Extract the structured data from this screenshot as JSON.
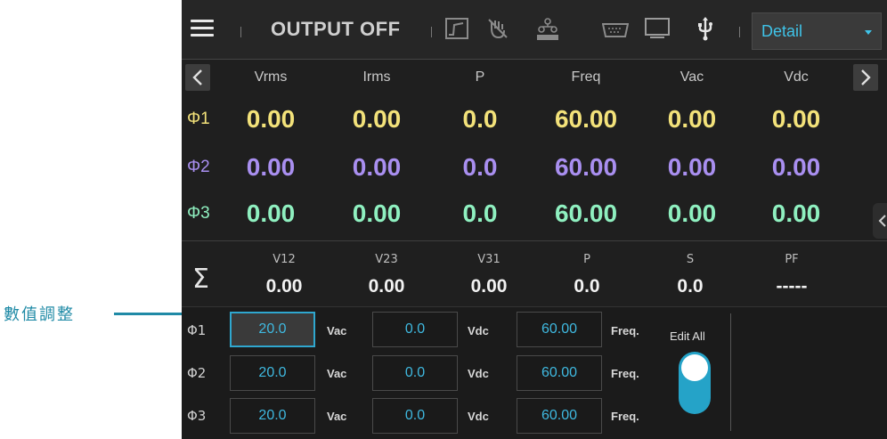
{
  "annotation": {
    "text": "數值調整"
  },
  "toolbar": {
    "status": "OUTPUT OFF",
    "view_select": "Detail",
    "icons": [
      "menu-icon",
      "waveform-icon",
      "hand-icon",
      "master-icon",
      "keyboard-icon",
      "monitor-icon",
      "usb-icon"
    ]
  },
  "measure": {
    "columns": [
      "Vrms",
      "Irms",
      "P",
      "Freq",
      "Vac",
      "Vdc"
    ],
    "rows": [
      {
        "label": "Φ1",
        "color": "#f3e27a",
        "values": [
          "0.00",
          "0.00",
          "0.0",
          "60.00",
          "0.00",
          "0.00"
        ]
      },
      {
        "label": "Φ2",
        "color": "#a98ff0",
        "values": [
          "0.00",
          "0.00",
          "0.0",
          "60.00",
          "0.00",
          "0.00"
        ]
      },
      {
        "label": "Φ3",
        "color": "#8ff0c0",
        "values": [
          "0.00",
          "0.00",
          "0.0",
          "60.00",
          "0.00",
          "0.00"
        ]
      }
    ]
  },
  "summary": {
    "symbol": "Σ",
    "columns": [
      "V12",
      "V23",
      "V31",
      "P",
      "S",
      "PF"
    ],
    "values": [
      "0.00",
      "0.00",
      "0.00",
      "0.0",
      "0.0",
      "-----"
    ]
  },
  "edit": {
    "units": {
      "vac": "Vac",
      "vdc": "Vdc",
      "freq": "Freq."
    },
    "rows": [
      {
        "label": "Φ1",
        "vac": "20.0",
        "vdc": "0.0",
        "freq": "60.00"
      },
      {
        "label": "Φ2",
        "vac": "20.0",
        "vdc": "0.0",
        "freq": "60.00"
      },
      {
        "label": "Φ3",
        "vac": "20.0",
        "vdc": "0.0",
        "freq": "60.00"
      }
    ],
    "edit_all_label": "Edit All",
    "edit_all_on": true
  },
  "colors": {
    "accent": "#2fa7cf",
    "annotation": "#1f8aa6"
  }
}
